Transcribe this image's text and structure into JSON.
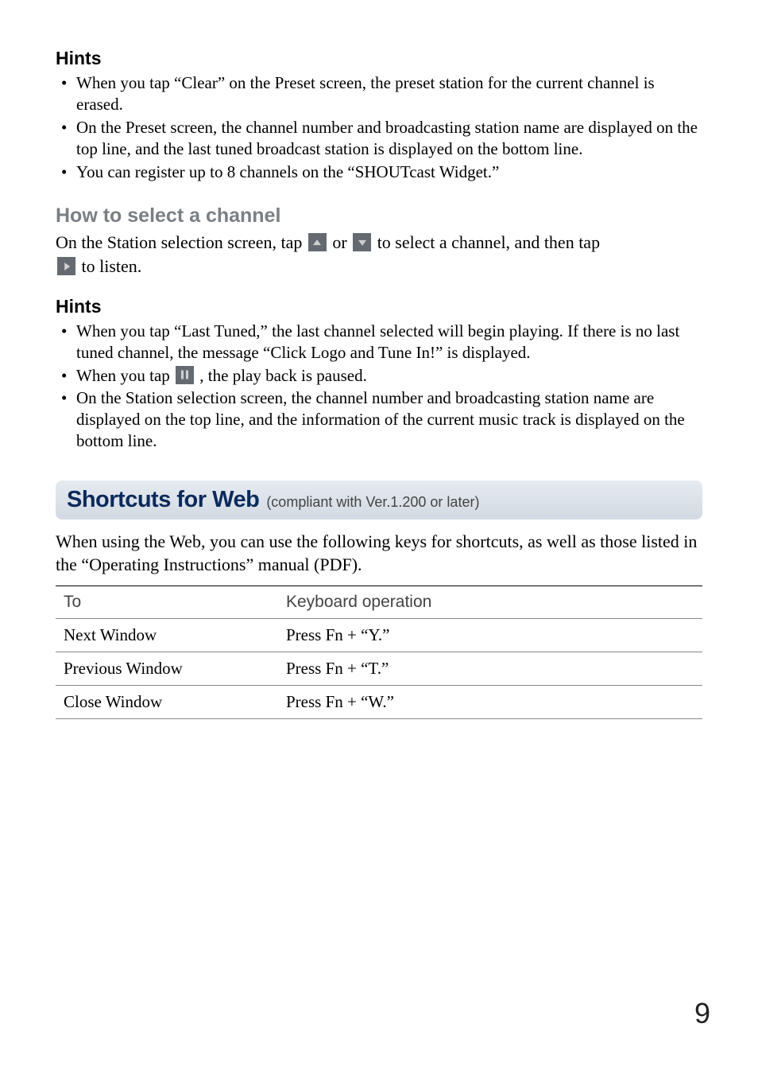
{
  "hints1": {
    "title": "Hints",
    "items": [
      "When you tap “Clear” on the Preset screen, the preset station for the current channel is erased.",
      "On the Preset screen, the channel number and broadcasting station name are displayed on the top line, and the last tuned broadcast station is displayed on the bottom line.",
      "You can register up to 8 channels on the “SHOUTcast Widget.”"
    ]
  },
  "how_to": {
    "heading": "How to select a channel",
    "text_a": "On the Station selection screen, tap ",
    "text_b": " or ",
    "text_c": " to select a channel, and then tap ",
    "text_d": " to listen."
  },
  "hints2": {
    "title": "Hints",
    "items": [
      "When you tap “Last Tuned,” the last channel selected will begin playing. If there is no last tuned channel, the message “Click Logo and Tune In!” is displayed.",
      null,
      "On the Station selection screen, the channel number and broadcasting station name are displayed on the top line, and the information of the current music track is displayed on the bottom line."
    ],
    "item2_a": "When you tap ",
    "item2_b": " , the play back is paused."
  },
  "shortcuts": {
    "title": "Shortcuts for Web",
    "subtitle": " (compliant with Ver.1.200 or later)",
    "intro": "When using the Web, you can use the following keys for shortcuts, as well as those listed in the “Operating Instructions” manual (PDF).",
    "headers": {
      "to": "To",
      "op": "Keyboard operation"
    },
    "rows": [
      {
        "to": "Next Window",
        "op": "Press Fn + “Y.”"
      },
      {
        "to": "Previous Window",
        "op": "Press Fn + “T.”"
      },
      {
        "to": "Close Window",
        "op": "Press Fn + “W.”"
      }
    ]
  },
  "page": "9"
}
